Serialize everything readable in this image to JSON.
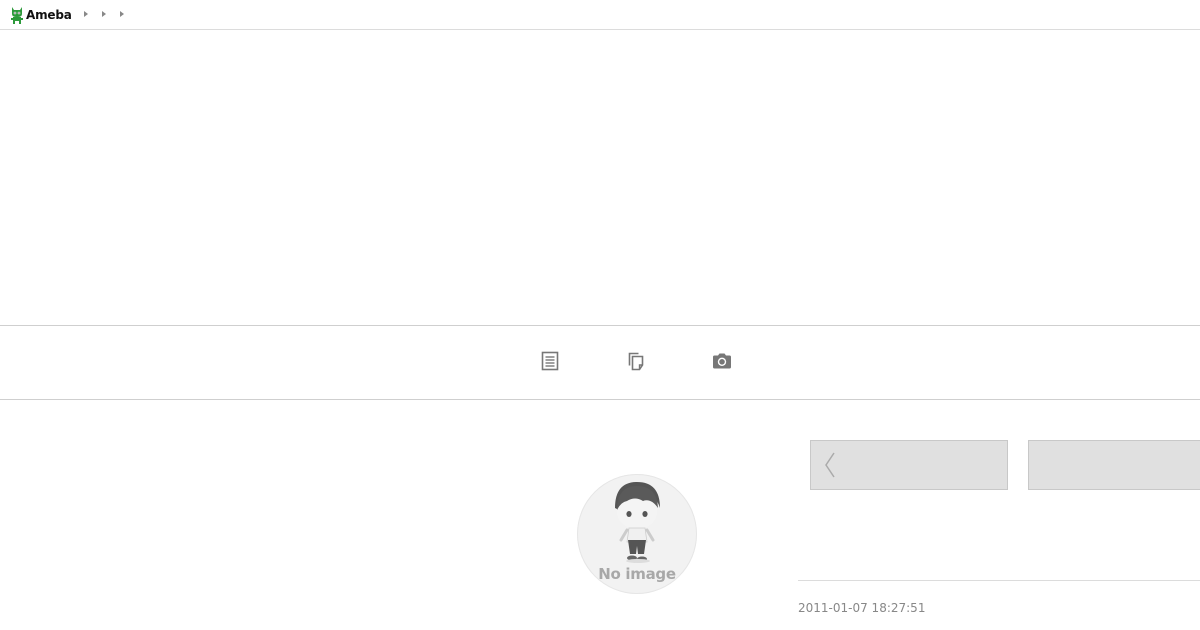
{
  "header": {
    "logo_text": "Ameba",
    "breadcrumb_count": 3
  },
  "toolbar": {
    "icons": [
      "article-icon",
      "copy-icon",
      "camera-icon"
    ]
  },
  "profile": {
    "avatar_text": "No image"
  },
  "entry": {
    "timestamp": "2011-01-07 18:27:51"
  },
  "colors": {
    "brand_green": "#2d9a3b",
    "nav_box_bg": "#e0e0e0",
    "icon_gray": "#777777"
  }
}
